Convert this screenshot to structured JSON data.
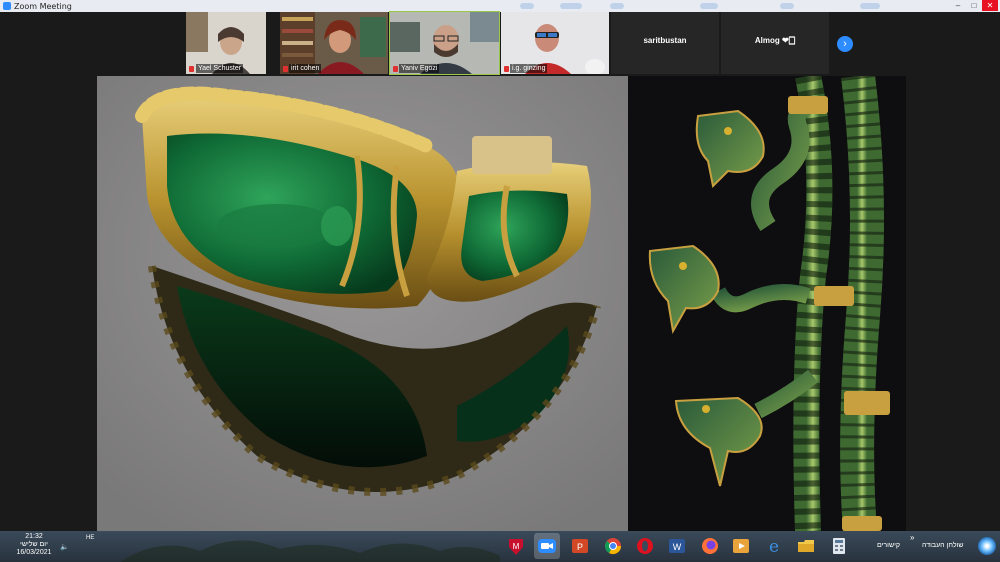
{
  "window": {
    "title": "Zoom Meeting",
    "controls": [
      "–",
      "□",
      "✕"
    ]
  },
  "gallery": {
    "participants": [
      {
        "name": "Yael Schuster"
      },
      {
        "name": "irit cohen"
      },
      {
        "name": "Yaniv Egozi"
      },
      {
        "name": "i.g. ginzing"
      },
      {
        "name": "saritbustan"
      },
      {
        "name": "Almog ❤🀆"
      }
    ],
    "next_icon": "chevron-right-icon"
  },
  "taskbar": {
    "clock_time": "21:32",
    "clock_day": "יום שלישי",
    "clock_date": "16/03/2021",
    "language": "HE",
    "links_label": "קישורים",
    "desktop_label": "שולחן העבודה",
    "expand_icon": "»",
    "apps": [
      {
        "icon": "mcafee-icon"
      },
      {
        "icon": "zoom-icon"
      },
      {
        "icon": "powerpoint-icon"
      },
      {
        "icon": "chrome-icon"
      },
      {
        "icon": "opera-icon"
      },
      {
        "icon": "word-icon"
      },
      {
        "icon": "firefox-icon"
      },
      {
        "icon": "media-player-icon"
      },
      {
        "icon": "edge-icon"
      },
      {
        "icon": "file-explorer-icon"
      },
      {
        "icon": "calculator-icon"
      }
    ]
  },
  "colors": {
    "zoom_blue": "#2d8cff",
    "background": "#1a1a1a"
  }
}
